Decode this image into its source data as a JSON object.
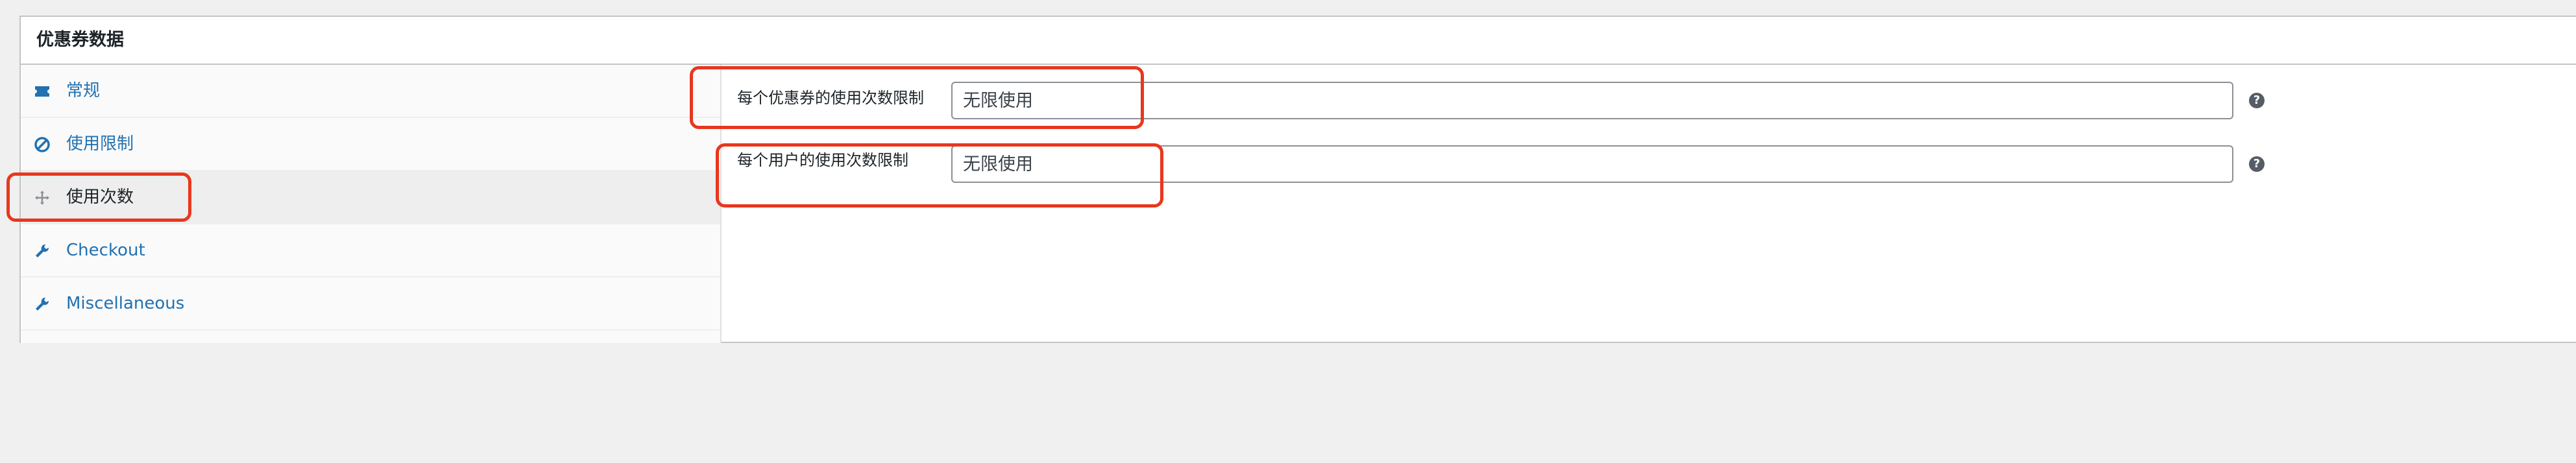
{
  "panel": {
    "title": "优惠券数据"
  },
  "tabs": [
    {
      "label": "常规",
      "icon": "ticket-icon",
      "active": false
    },
    {
      "label": "使用限制",
      "icon": "prohibited-icon",
      "active": false
    },
    {
      "label": "使用次数",
      "icon": "move-icon",
      "active": true
    },
    {
      "label": "Checkout",
      "icon": "wrench-icon",
      "active": false
    },
    {
      "label": "Miscellaneous",
      "icon": "wrench-icon",
      "active": false
    }
  ],
  "fields": [
    {
      "label": "每个优惠券的使用次数限制",
      "value": "无限使用",
      "help": "?"
    },
    {
      "label": "每个用户的使用次数限制",
      "value": "无限使用",
      "help": "?"
    }
  ],
  "colors": {
    "link": "#2271b1",
    "highlight": "#e8371e",
    "active_tab_bg": "#eeeeee"
  }
}
